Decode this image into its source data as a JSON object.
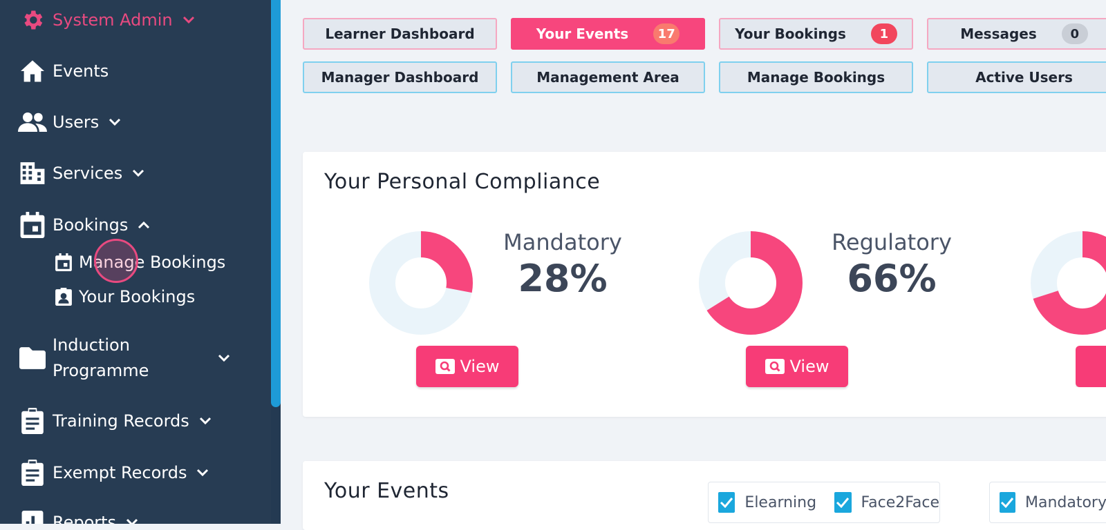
{
  "sidebar": {
    "system_admin": "System Admin",
    "items": [
      {
        "label": "Events",
        "icon": "home-icon"
      },
      {
        "label": "Users",
        "icon": "users-icon"
      },
      {
        "label": "Services",
        "icon": "building-icon"
      },
      {
        "label": "Bookings",
        "icon": "calendar-icon"
      },
      {
        "label": "Induction",
        "label2": "Programme",
        "icon": "folder-icon"
      },
      {
        "label": "Training Records",
        "icon": "clipboard-icon"
      },
      {
        "label": "Exempt Records",
        "icon": "clipboard-icon"
      },
      {
        "label": "Reports",
        "icon": "chart-icon"
      }
    ],
    "sub_items": [
      {
        "label": "Manage Bookings",
        "icon": "calendar-icon"
      },
      {
        "label": "Your Bookings",
        "icon": "contact-icon"
      }
    ]
  },
  "topbar": {
    "learner_dashboard": "Learner Dashboard",
    "your_events": "Your Events",
    "your_events_count": "17",
    "your_bookings": "Your Bookings",
    "your_bookings_count": "1",
    "messages": "Messages",
    "messages_count": "0",
    "manager_dashboard": "Manager Dashboard",
    "management_area": "Management Area",
    "manage_bookings": "Manage Bookings",
    "active_users": "Active Users"
  },
  "compliance": {
    "title": "Your Personal Compliance",
    "view_label": "View",
    "items": [
      {
        "category": "Mandatory",
        "percent_label": "28%",
        "value": 28
      },
      {
        "category": "Regulatory",
        "percent_label": "66%",
        "value": 66
      },
      {
        "category": "",
        "percent_label": "",
        "value": 70
      }
    ]
  },
  "events": {
    "title": "Your Events",
    "filters": [
      "Elearning",
      "Face2Face",
      "Mandatory"
    ]
  },
  "colors": {
    "accent_pink": "#f7467d",
    "sidebar_bg": "#273c53",
    "donut_track": "#eaf4fa",
    "checkbox_blue": "#1aa7dd"
  }
}
